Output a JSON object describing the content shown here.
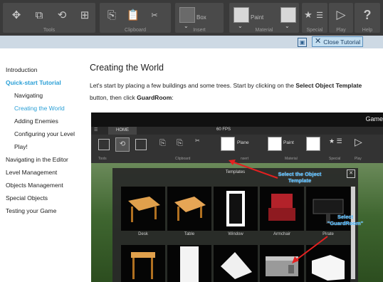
{
  "toolbar": {
    "groups": {
      "tools": "Tools",
      "clipboard": "Clipboard",
      "insert": "Insert",
      "material": "Material",
      "special": "Special",
      "play": "Play",
      "help": "Help"
    },
    "box_label": "Box",
    "paint_label": "Paint"
  },
  "banner": {
    "close_label": "Close Tutorial"
  },
  "sidebar": {
    "items": [
      {
        "label": "Introduction"
      },
      {
        "label": "Quick-start Tutorial"
      },
      {
        "label": "Navigating"
      },
      {
        "label": "Creating the World"
      },
      {
        "label": "Adding Enemies"
      },
      {
        "label": "Configuring your Level"
      },
      {
        "label": "Play!"
      },
      {
        "label": "Navigating in the Editor"
      },
      {
        "label": "Level Management"
      },
      {
        "label": "Objects Management"
      },
      {
        "label": "Special Objects"
      },
      {
        "label": "Testing your Game"
      }
    ]
  },
  "main": {
    "title": "Creating the World",
    "para_1": "Let's start by placing a few buildings and some trees. Start by clicking on the ",
    "para_bold_1": "Select Object Template",
    "para_2": " button, then click ",
    "para_bold_2": "GuardRoom",
    "para_3": ":"
  },
  "screenshot": {
    "title": "Game",
    "home_tab": "HOME",
    "fps": "60 FPS",
    "plane_label": "Plane",
    "paint_label": "Paint",
    "groups": {
      "tools": "Tools",
      "clipboard": "Clipboard",
      "insert": "nsert",
      "material": "Material",
      "special": "Special",
      "play": "Play"
    },
    "panel_title": "Templates",
    "items": [
      "Desk",
      "Table",
      "Window",
      "Armchair",
      "Pirate"
    ],
    "annotation_1": "Select the Object Template",
    "annotation_2": "Select \"GuardRoom\""
  }
}
